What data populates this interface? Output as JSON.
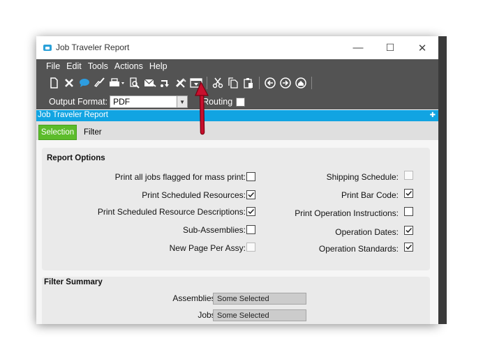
{
  "window": {
    "title": "Job Traveler Report"
  },
  "titlebar": {
    "minimize": "—",
    "maximize": "☐",
    "close": "✕"
  },
  "menu": {
    "items": [
      "File",
      "Edit",
      "Tools",
      "Actions",
      "Help"
    ]
  },
  "toolbar": {
    "output_format_label": "Output Format:",
    "output_format_value": "PDF",
    "routing_label": "Routing",
    "icons": [
      "new-icon",
      "delete-icon",
      "chat-icon",
      "clear-icon",
      "print-icon",
      "print-preview-icon",
      "email-icon",
      "generate-only-icon",
      "edit-in-designer-icon",
      "schedule-icon",
      "cut-icon",
      "copy-icon",
      "paste-icon",
      "back-icon",
      "forward-icon",
      "home-icon"
    ]
  },
  "panel": {
    "header": "Job Traveler Report"
  },
  "tabs": {
    "selection": "Selection",
    "filter": "Filter"
  },
  "report_options": {
    "title": "Report Options",
    "left": [
      {
        "label": "Print all jobs flagged for mass print:",
        "checked": false,
        "enabled": true
      },
      {
        "label": "Print Scheduled Resources:",
        "checked": true,
        "enabled": true
      },
      {
        "label": "Print Scheduled Resource Descriptions:",
        "checked": true,
        "enabled": true
      },
      {
        "label": "Sub-Assemblies:",
        "checked": false,
        "enabled": true
      },
      {
        "label": "New Page Per Assy:",
        "checked": false,
        "enabled": false
      }
    ],
    "right": [
      {
        "label": "Shipping Schedule:",
        "checked": false,
        "enabled": false
      },
      {
        "label": "Print Bar Code:",
        "checked": true,
        "enabled": true
      },
      {
        "label": "Print Operation Instructions:",
        "checked": false,
        "enabled": true
      },
      {
        "label": "Operation Dates:",
        "checked": true,
        "enabled": true
      },
      {
        "label": "Operation Standards:",
        "checked": true,
        "enabled": true
      }
    ]
  },
  "filter_summary": {
    "title": "Filter Summary",
    "assemblies_label": "Assemblies:",
    "assemblies_value": "Some Selected",
    "jobs_label": "Jobs:",
    "jobs_value": "Some Selected"
  },
  "colors": {
    "accent": "#11a4e2",
    "tab_active": "#5cbc2b",
    "toolbar": "#535353",
    "annotation_arrow": "#c8102e"
  }
}
